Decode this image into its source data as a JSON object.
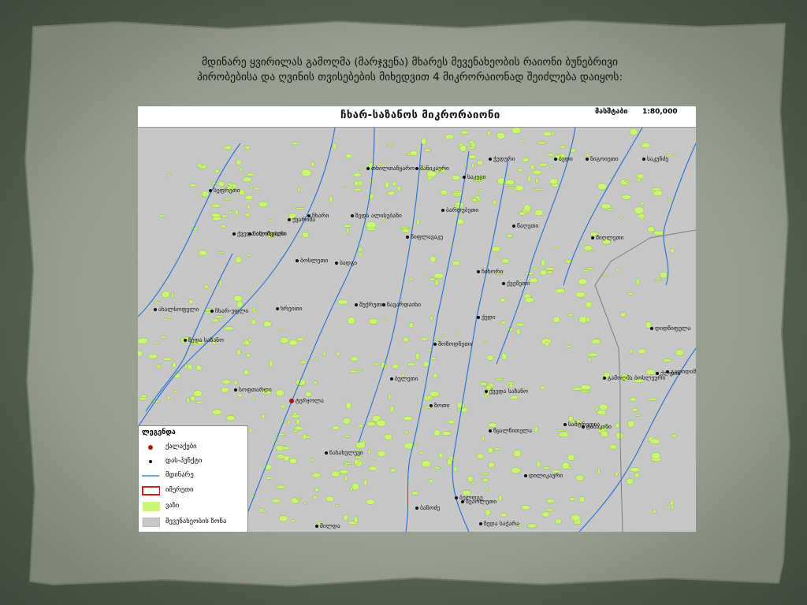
{
  "slide": {
    "title_line1": "მდინარე ყვირილას გამოღმა (მარჯვენა) მხარეს მევენახეობის რაიონი ბუნებრივი",
    "title_line2": "პირობებისა და ღვინის თვისებების მიხედვით 4 მიკრორაიონად შეიძლება დაიყოს:"
  },
  "map": {
    "title": "ჩხარ-საზანოს  მიკრორაიონი",
    "scale_label": "მასშტაბი",
    "scale_value": "1:80,000",
    "colors": {
      "background": "#c7c7c7",
      "vineyard": "#ccf573",
      "vineyard_edge": "#7aa84a",
      "river": "#1f6fd6",
      "town": "#b01010",
      "border": "#7a7a7a"
    },
    "places": [
      {
        "name": "თხილთაწყარო",
        "type": "village"
      },
      {
        "name": "მანიკაური",
        "type": "village"
      },
      {
        "name": "საკეცი",
        "type": "village"
      },
      {
        "name": "ჭედური",
        "type": "village"
      },
      {
        "name": "ბედი",
        "type": "village"
      },
      {
        "name": "ნიგოიეთი",
        "type": "village"
      },
      {
        "name": "საკუნძე",
        "type": "village"
      },
      {
        "name": "სეფრეთი",
        "type": "village"
      },
      {
        "name": "ქვარიშა",
        "type": "village"
      },
      {
        "name": "ჩხარი",
        "type": "village"
      },
      {
        "name": "ზედა ალისუბანი",
        "type": "village"
      },
      {
        "name": "ბარდუბეთი",
        "type": "village"
      },
      {
        "name": "წაღეთი",
        "type": "village"
      },
      {
        "name": "ქვედა ალისუბანი",
        "type": "village"
      },
      {
        "name": "წიფლავაკე",
        "type": "village"
      },
      {
        "name": "მიღლეთი",
        "type": "village"
      },
      {
        "name": "ბოსლეთი",
        "type": "village"
      },
      {
        "name": "ბადგი",
        "type": "village"
      },
      {
        "name": "ნინოშვილი",
        "type": "village"
      },
      {
        "name": "ჩიხორი",
        "type": "village"
      },
      {
        "name": "ქვეშეთი",
        "type": "village"
      },
      {
        "name": "შუქრუთი",
        "type": "village"
      },
      {
        "name": "ნავარდაიხი",
        "type": "village"
      },
      {
        "name": "ახალსოფელი",
        "type": "village"
      },
      {
        "name": "ჩხარ-უფლი",
        "type": "village"
      },
      {
        "name": "ხრეითი",
        "type": "village"
      },
      {
        "name": "ქედი",
        "type": "village"
      },
      {
        "name": "ზედა საზანო",
        "type": "village"
      },
      {
        "name": "დიდწიფელა",
        "type": "village"
      },
      {
        "name": "მოზოდნეთი",
        "type": "village"
      },
      {
        "name": "სოფთარდი",
        "type": "village"
      },
      {
        "name": "ბულეთი",
        "type": "village"
      },
      {
        "name": "გადიდიშელი",
        "type": "village"
      },
      {
        "name": "გამოღმა ბოსლეური",
        "type": "village"
      },
      {
        "name": "ქლეთი",
        "type": "village"
      },
      {
        "name": "სამტრედია",
        "type": "village"
      },
      {
        "name": "ტერჯოლა",
        "type": "town"
      },
      {
        "name": "ქვედა საზანო",
        "type": "village"
      },
      {
        "name": "ზოთი",
        "type": "village"
      },
      {
        "name": "ტაბაკინი",
        "type": "village"
      },
      {
        "name": "წყალწითელა",
        "type": "village"
      },
      {
        "name": "ნახახულევი",
        "type": "village"
      },
      {
        "name": "დილიკაური",
        "type": "village"
      },
      {
        "name": "ბელოგე",
        "type": "village"
      },
      {
        "name": "ბანოძე",
        "type": "village"
      },
      {
        "name": "შილდა",
        "type": "village"
      },
      {
        "name": "ზედა საქარა",
        "type": "village"
      },
      {
        "name": "სეპოლეთი",
        "type": "village"
      }
    ]
  },
  "legend": {
    "title": "ლეგენდა",
    "items": [
      {
        "label": "ქალაქები",
        "symbol": "town-dot"
      },
      {
        "label": "დას-პუნქტი",
        "symbol": "village-dot"
      },
      {
        "label": "მდინარე",
        "symbol": "river-line"
      },
      {
        "label": "იმერეთი",
        "symbol": "region-outline"
      },
      {
        "label": "ვაზი",
        "symbol": "vineyard-fill"
      },
      {
        "label": "მევენახეობის ზონა",
        "symbol": "zone-fill"
      }
    ]
  }
}
